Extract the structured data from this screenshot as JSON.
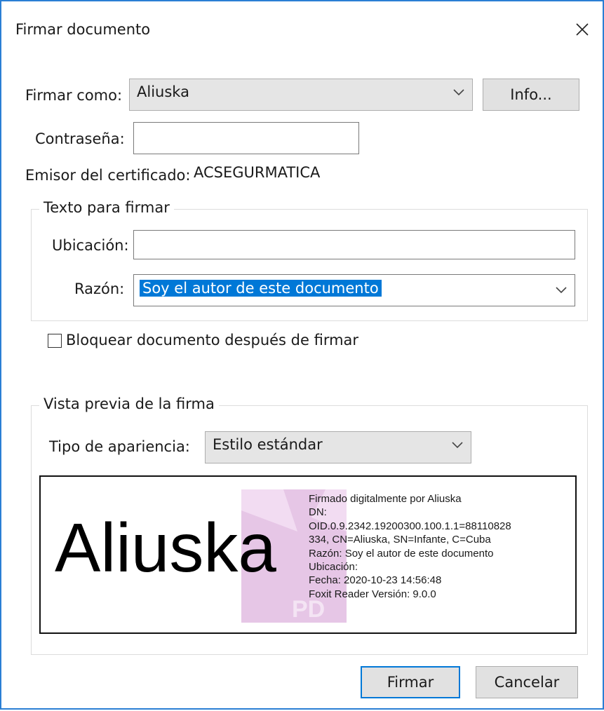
{
  "dialog": {
    "title": "Firmar documento"
  },
  "sign_as": {
    "label": "Firmar como:",
    "value": "Aliuska",
    "info_button": "Info..."
  },
  "password": {
    "label": "Contraseña:",
    "value": ""
  },
  "issuer": {
    "label": "Emisor del certificado:",
    "value": "ACSEGURMATICA"
  },
  "text_group": {
    "legend": "Texto para firmar",
    "location_label": "Ubicación:",
    "location_value": "",
    "reason_label": "Razón:",
    "reason_value": "Soy el autor de este documento"
  },
  "lock_checkbox": {
    "label": "Bloquear documento después de firmar",
    "checked": false
  },
  "preview_group": {
    "legend": "Vista previa de la firma",
    "appearance_label": "Tipo de apariencia:",
    "appearance_value": "Estilo estándar",
    "signature": {
      "name": "Aliuska",
      "lines": [
        "Firmado digitalmente por Aliuska",
        "DN:",
        "OID.0.9.2342.19200300.100.1.1=88110828",
        "334, CN=Aliuska, SN=Infante, C=Cuba",
        "Razón: Soy el autor de este documento",
        "Ubicación:",
        "Fecha: 2020-10-23 14:56:48",
        "Foxit Reader Versión: 9.0.0"
      ],
      "watermark_text": "PD"
    }
  },
  "buttons": {
    "sign": "Firmar",
    "cancel": "Cancelar"
  },
  "colors": {
    "accent": "#0078d7",
    "window_border": "#2a7fd4",
    "watermark": "#d9b3d9"
  },
  "icons": {
    "close": "close-icon",
    "dropdown": "chevron-down-icon"
  }
}
